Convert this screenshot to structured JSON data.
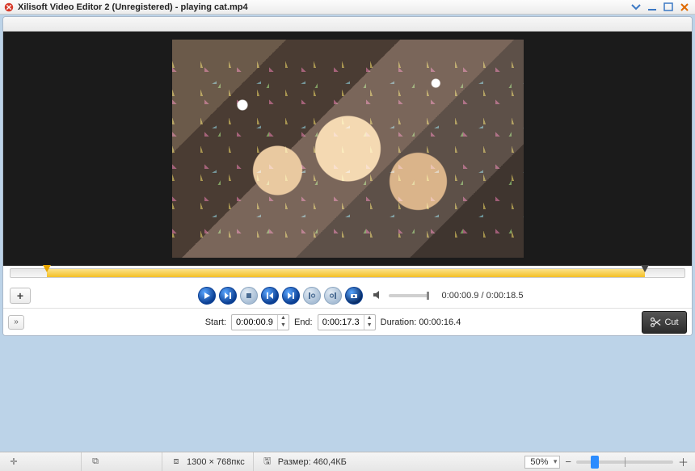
{
  "titlebar": {
    "title": "Xilisoft Video Editor 2 (Unregistered) - playing cat.mp4"
  },
  "playback": {
    "time_readout": "0:00:00.9 / 0:00:18.5"
  },
  "cut": {
    "start_label": "Start:",
    "start_value": "0:00:00.9",
    "end_label": "End:",
    "end_value": "0:00:17.3",
    "duration_label": "Duration: 00:00:16.4",
    "button_label": "Cut"
  },
  "status": {
    "dimensions": "1300 × 768пкс",
    "size_label": "Размер: 460,4КБ",
    "zoom_value": "50%"
  }
}
